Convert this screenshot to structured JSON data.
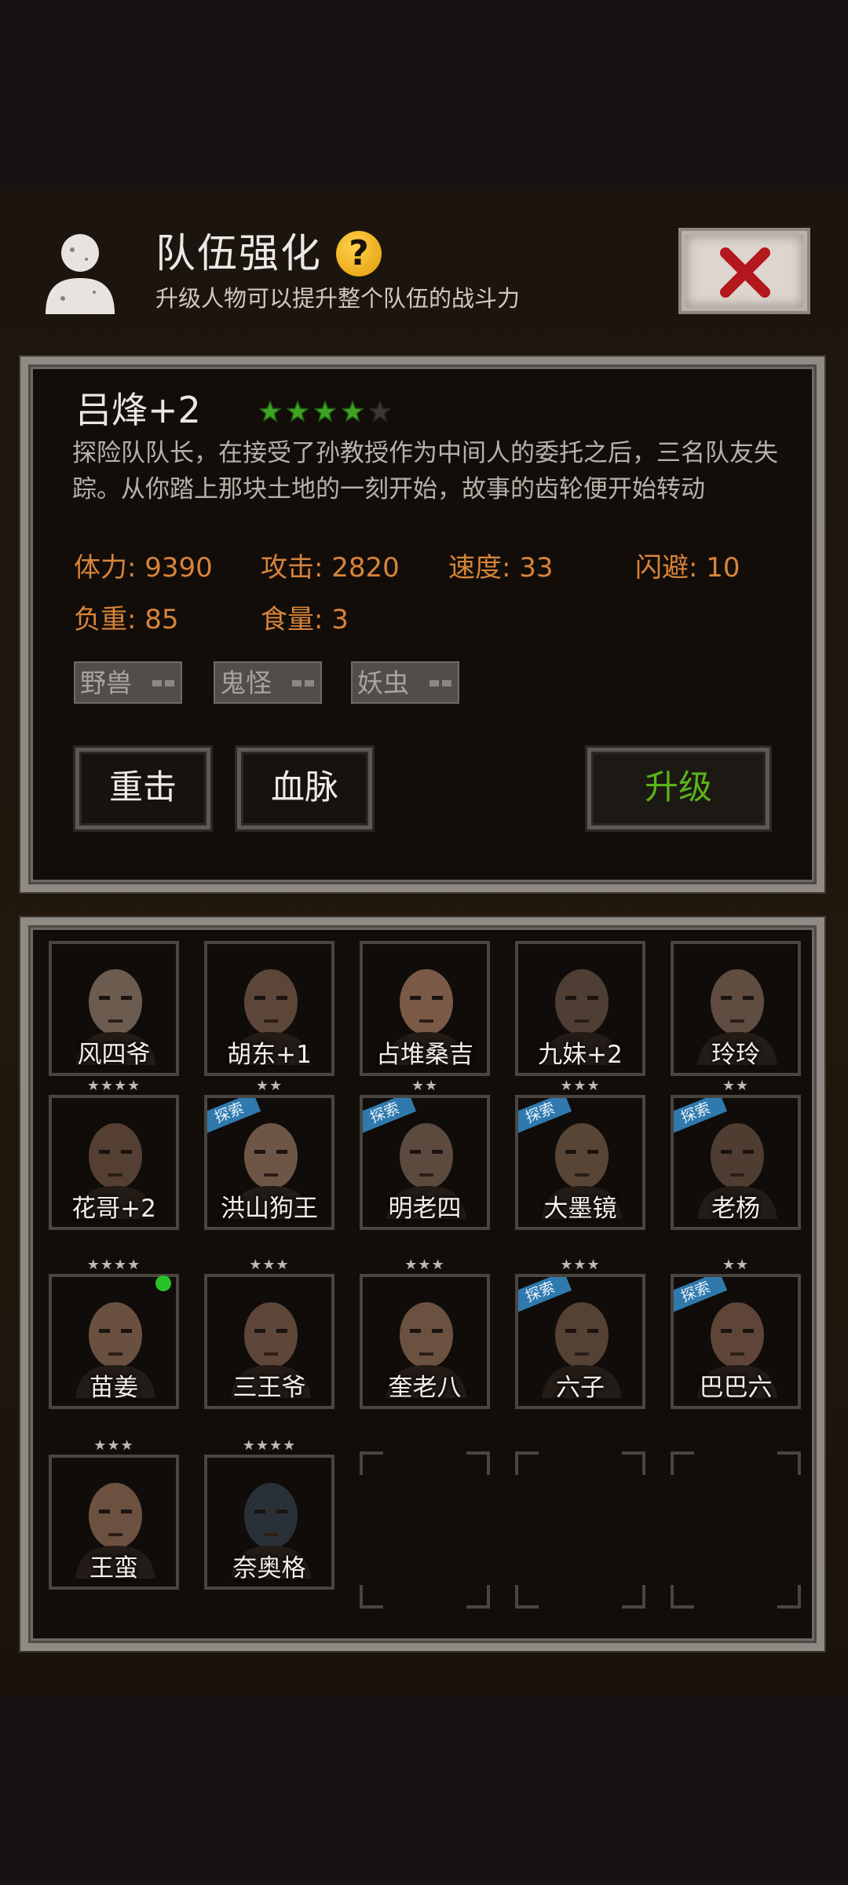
{
  "header": {
    "title": "队伍强化",
    "help_glyph": "?",
    "subtitle": "升级人物可以提升整个队伍的战斗力"
  },
  "character": {
    "name": "吕烽+2",
    "stars_filled": 4,
    "stars_total": 5,
    "description": "探险队队长，在接受了孙教授作为中间人的委托之后，三名队友失踪。从你踏上那块土地的一刻开始，故事的齿轮便开始转动",
    "stats": {
      "hp": "体力: 9390",
      "attack": "攻击: 2820",
      "speed": "速度: 33",
      "dodge": "闪避: 10",
      "load": "负重: 85",
      "food": "食量: 3"
    },
    "tags": [
      "野兽",
      "鬼怪",
      "妖虫"
    ]
  },
  "buttons": {
    "heavy_strike": "重击",
    "bloodline": "血脉",
    "upgrade": "升级"
  },
  "roster": [
    {
      "name": "风四爷",
      "stars": "",
      "explore": false
    },
    {
      "name": "胡东+1",
      "stars": "",
      "explore": false
    },
    {
      "name": "占堆桑吉",
      "stars": "",
      "explore": false
    },
    {
      "name": "九妹+2",
      "stars": "",
      "explore": false
    },
    {
      "name": "玲玲",
      "stars": "",
      "explore": false
    },
    {
      "name": "花哥+2",
      "stars": "★★★★",
      "explore": false
    },
    {
      "name": "洪山狗王",
      "stars": "★★",
      "explore": true
    },
    {
      "name": "明老四",
      "stars": "★★",
      "explore": true
    },
    {
      "name": "大墨镜",
      "stars": "★★★",
      "explore": true
    },
    {
      "name": "老杨",
      "stars": "★★",
      "explore": true
    },
    {
      "name": "苗姜",
      "stars": "★★★★",
      "explore": false,
      "online": true
    },
    {
      "name": "三王爷",
      "stars": "★★★",
      "explore": false
    },
    {
      "name": "奎老八",
      "stars": "★★★",
      "explore": false
    },
    {
      "name": "六子",
      "stars": "★★★",
      "explore": true
    },
    {
      "name": "巴巴六",
      "stars": "★★",
      "explore": true
    },
    {
      "name": "王蛮",
      "stars": "★★★",
      "explore": false
    },
    {
      "name": "奈奥格",
      "stars": "★★★★",
      "explore": false
    }
  ],
  "explore_badge": "探索",
  "colors": {
    "stat_orange": "#d6843a",
    "upgrade_green": "#5bb31a",
    "star_green": "#3fa324",
    "explore_blue": "#2f79ad"
  }
}
